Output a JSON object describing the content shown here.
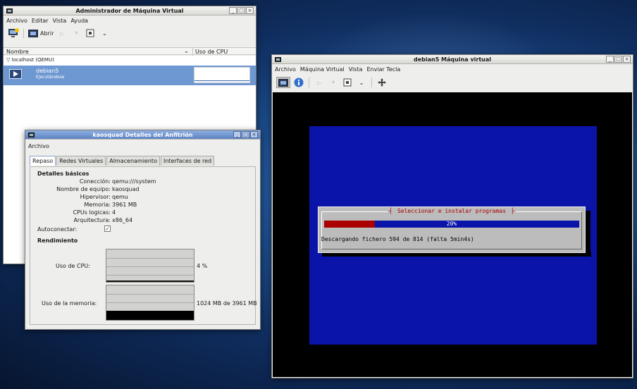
{
  "manager": {
    "title": "Administrador de Máquina Virtual",
    "menu": [
      "Archivo",
      "Editar",
      "Vista",
      "Ayuda"
    ],
    "open_label": "Abrir",
    "col_name": "Nombre",
    "col_cpu": "Uso de CPU",
    "group": "localhost (QEMU)",
    "vm_name": "debian5",
    "vm_status": "Ejecutándose"
  },
  "details": {
    "title": "kaosquad Detalles del Anfitrión",
    "menu": "Archivo",
    "tabs": [
      "Repaso",
      "Redes Virtuales",
      "Almacenamiento",
      "Interfaces de red"
    ],
    "basic_title": "Detalles básicos",
    "fields": [
      {
        "label": "Conección:",
        "value": "qemu:///system"
      },
      {
        "label": "Nombre de equipo:",
        "value": "kaosquad"
      },
      {
        "label": "Hipervisor:",
        "value": "qemu"
      },
      {
        "label": "Memoria:",
        "value": "3961 MB"
      },
      {
        "label": "CPUs logicas:",
        "value": "4"
      },
      {
        "label": "Arquitectura:",
        "value": "x86_64"
      }
    ],
    "autoconnect_label": "Autoconectar:",
    "autoconnect_checked": true,
    "perf_title": "Rendimiento",
    "cpu_label": "Uso de CPU:",
    "cpu_value": "4 %",
    "cpu_percent": 4,
    "mem_label": "Uso de la memoria:",
    "mem_value": "1024 MB de 3961 MB",
    "mem_fraction": 0.26
  },
  "vm": {
    "title": "debian5 Máquina virtual",
    "menu": [
      "Archivo",
      "Máquina Virtual",
      "Vista",
      "Enviar Tecla"
    ],
    "installer": {
      "dialog_title": "Seleccionar e instalar programas",
      "progress_percent": 20,
      "progress_text": "20%",
      "message": "Descargando fichero 594 de 814 (falta 5min4s)"
    }
  }
}
